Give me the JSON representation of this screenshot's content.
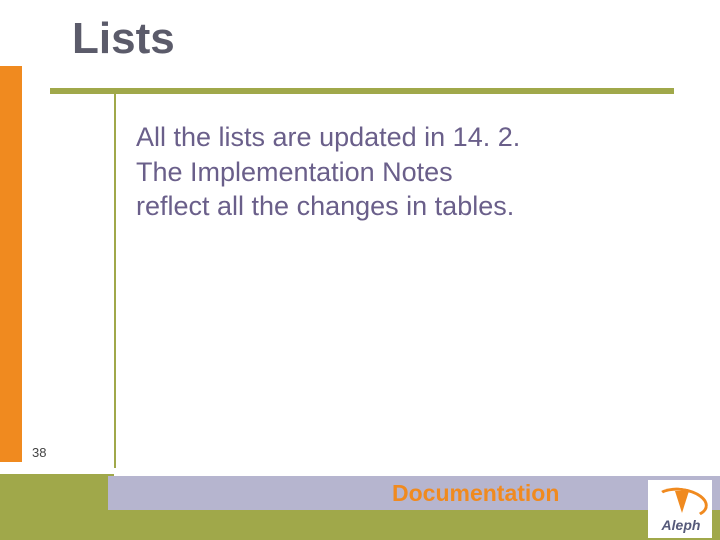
{
  "title": "Lists",
  "body_lines": [
    "All the lists are updated in 14. 2.",
    "The Implementation Notes",
    "reflect all the changes in tables."
  ],
  "page_number": "38",
  "footer_label": "Documentation",
  "logo_text": "Aleph",
  "colors": {
    "orange": "#f08a1f",
    "olive": "#a0a84a",
    "violet_bar": "#b6b5cf",
    "title_gray": "#5b5b6a",
    "body_violet": "#6a5f8a"
  }
}
